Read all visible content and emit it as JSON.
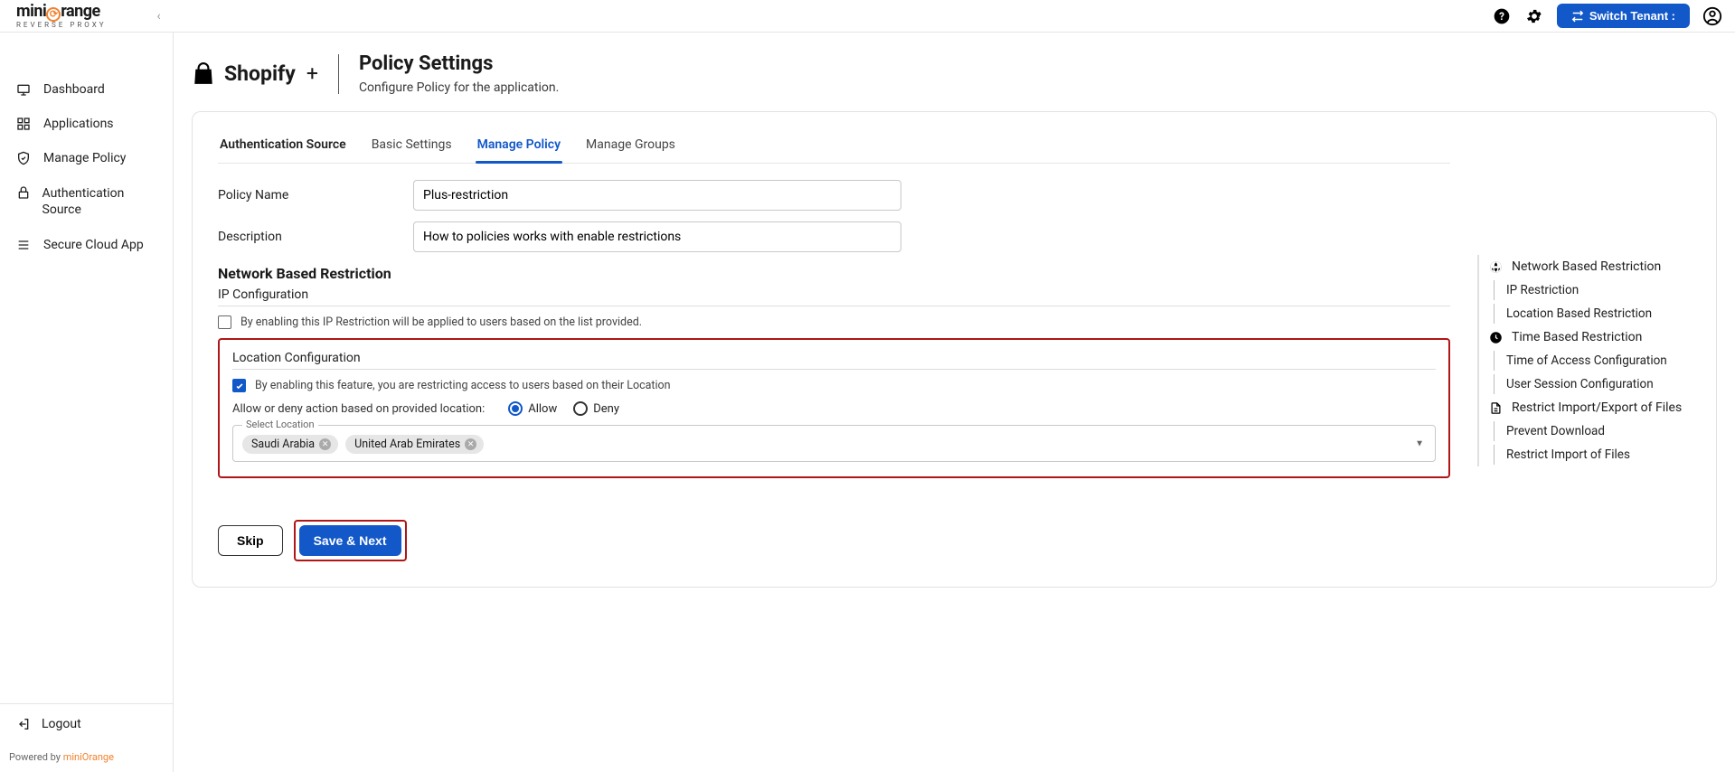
{
  "brand": {
    "name": "miniOrange",
    "sub": "REVERSE PROXY"
  },
  "header": {
    "switch_tenant": "Switch Tenant :"
  },
  "sidebar": {
    "items": [
      {
        "label": "Dashboard"
      },
      {
        "label": "Applications"
      },
      {
        "label": "Manage Policy"
      },
      {
        "label": "Authentication Source"
      },
      {
        "label": "Secure Cloud App"
      }
    ],
    "logout": "Logout",
    "powered_prefix": "Powered by ",
    "powered_brand": "miniOrange"
  },
  "page": {
    "app_name": "Shopify",
    "app_plus": "+",
    "title": "Policy Settings",
    "subtitle": "Configure Policy for the application."
  },
  "tabs": [
    {
      "label": "Authentication Source",
      "active": false,
      "bold": true
    },
    {
      "label": "Basic Settings",
      "active": false
    },
    {
      "label": "Manage Policy",
      "active": true
    },
    {
      "label": "Manage Groups",
      "active": false
    }
  ],
  "form": {
    "policy_name_label": "Policy Name",
    "policy_name_value": "Plus-restriction",
    "description_label": "Description",
    "description_value": "How to policies works with enable restrictions"
  },
  "network": {
    "heading": "Network Based Restriction",
    "ip_heading": "IP Configuration",
    "ip_check_label": "By enabling this IP Restriction will be applied to users based on the list provided.",
    "loc_heading": "Location Configuration",
    "loc_check_label": "By enabling this feature, you are restricting access to users based on their Location",
    "radio_prompt": "Allow or deny action based on provided location:",
    "radio_allow": "Allow",
    "radio_deny": "Deny",
    "select_label": "Select Location",
    "chips": [
      "Saudi Arabia",
      "United Arab Emirates"
    ]
  },
  "actions": {
    "skip": "Skip",
    "save": "Save & Next"
  },
  "outline": {
    "items": [
      {
        "label": "Network Based Restriction",
        "icon": "globe"
      },
      {
        "label": "IP Restriction",
        "sub": true
      },
      {
        "label": "Location Based Restriction",
        "sub": true
      },
      {
        "label": "Time Based Restriction",
        "icon": "clock"
      },
      {
        "label": "Time of Access Configuration",
        "sub": true
      },
      {
        "label": "User Session Configuration",
        "sub": true
      },
      {
        "label": "Restrict Import/Export of Files",
        "icon": "file"
      },
      {
        "label": "Prevent Download",
        "sub": true
      },
      {
        "label": "Restrict Import of Files",
        "sub": true
      }
    ]
  }
}
